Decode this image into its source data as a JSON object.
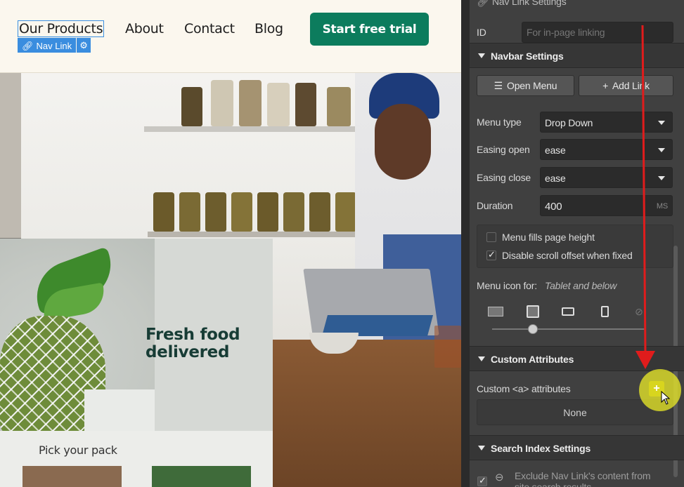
{
  "navbar": {
    "links": [
      "Our Products",
      "About",
      "Contact",
      "Blog"
    ],
    "cta_label": "Start free trial",
    "selection_badge_label": "Nav Link",
    "selection_badge_icon": "link-icon"
  },
  "hero": {
    "card_heading_line1": "Fresh food",
    "card_heading_line2": "delivered",
    "pack_title": "Pick your pack"
  },
  "panel": {
    "top_section_title": "Nav Link Settings",
    "id_label": "ID",
    "id_placeholder": "For in-page linking",
    "navbar_settings": {
      "title": "Navbar Settings",
      "open_menu_label": "Open Menu",
      "add_link_label": "Add Link",
      "menu_type_label": "Menu type",
      "menu_type_value": "Drop Down",
      "easing_open_label": "Easing open",
      "easing_open_value": "ease",
      "easing_close_label": "Easing close",
      "easing_close_value": "ease",
      "duration_label": "Duration",
      "duration_value": "400",
      "duration_unit": "MS",
      "menu_fills_label": "Menu fills page height",
      "menu_fills_checked": false,
      "disable_scroll_label": "Disable scroll offset when fixed",
      "disable_scroll_checked": true,
      "menu_icon_for_label": "Menu icon for:",
      "menu_icon_for_value": "Tablet and below"
    },
    "custom_attributes": {
      "title": "Custom Attributes",
      "label": "Custom <a> attributes",
      "empty_text": "None",
      "add_label": "+"
    },
    "search_index": {
      "title": "Search Index Settings",
      "exclude_label_line1": "Exclude Nav Link's content from",
      "exclude_label_line2": "site search results"
    }
  },
  "colors": {
    "cta": "#0c7c5d",
    "selection": "#3a8ddf",
    "panel_bg": "#404040",
    "annotation_arrow": "#e01c1c",
    "cursor_highlight": "#e6e628"
  }
}
